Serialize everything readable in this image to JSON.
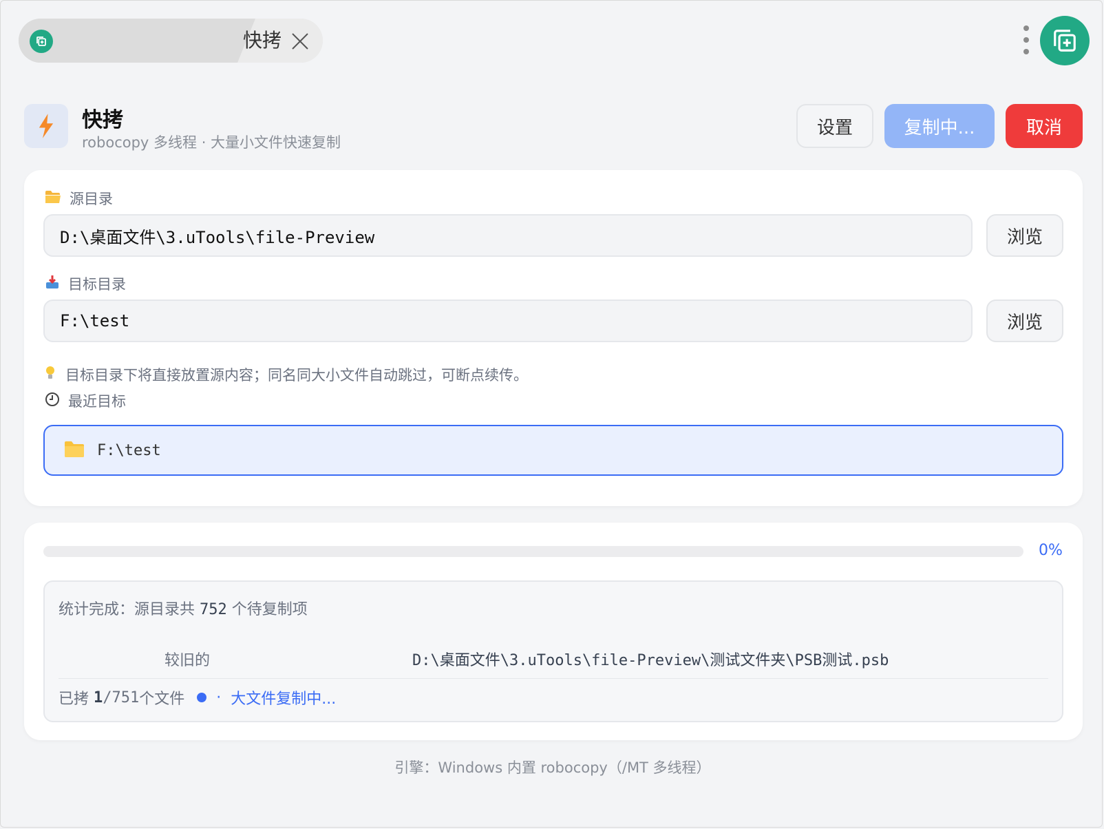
{
  "tab": {
    "label": "快拷"
  },
  "header": {
    "title": "快拷",
    "subtitle": "robocopy 多线程 · 大量小文件快速复制",
    "settings_label": "设置",
    "copying_label": "复制中...",
    "cancel_label": "取消"
  },
  "source": {
    "label": "源目录",
    "value": "D:\\桌面文件\\3.uTools\\file-Preview",
    "browse_label": "浏览"
  },
  "target": {
    "label": "目标目录",
    "value": "F:\\test",
    "browse_label": "浏览"
  },
  "hint": "目标目录下将直接放置源内容；同名同大小文件自动跳过，可断点续传。",
  "recent": {
    "label": "最近目标",
    "items": [
      {
        "path": "F:\\test"
      }
    ]
  },
  "progress": {
    "percent": 0,
    "percent_label": "0%"
  },
  "log": {
    "summary_prefix": "统计完成：源目录共 ",
    "summary_count": "752",
    "summary_suffix": " 个待复制项",
    "entry_kind": "较旧的",
    "entry_path": "D:\\桌面文件\\3.uTools\\file-Preview\\测试文件夹\\PSB测试.psb",
    "copied_prefix": "已拷 ",
    "copied_done": "1",
    "copied_sep": " / ",
    "copied_total": "751",
    "copied_suffix": " 个文件",
    "status_sep": "·",
    "status": "大文件复制中..."
  },
  "footer": "引擎：Windows 内置 robocopy（/MT 多线程）",
  "colors": {
    "accent": "#3b6cf5",
    "brand": "#22a985",
    "danger": "#ef3b3b",
    "copying": "#93b5f7"
  }
}
